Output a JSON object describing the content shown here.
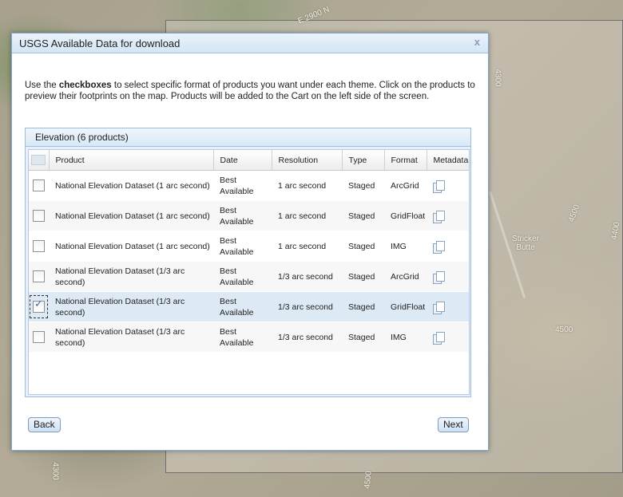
{
  "map": {
    "labels": {
      "road": "E 2900 N",
      "contour_1": "4300",
      "contour_2": "4500",
      "contour_3": "4500",
      "contour_4": "4400",
      "contour_5": "4300",
      "contour_6": "4500",
      "place": "Stricker Butte"
    }
  },
  "dialog": {
    "title": "USGS Available Data for download",
    "close": "x",
    "instructions": {
      "part1": "Use the ",
      "bold": "checkboxes",
      "part2": " to select specific format of products you want under each theme. Click on the products to preview their footprints on the map. Products will be added to the Cart on the left side of the screen."
    },
    "panel_title": "Elevation (6 products)",
    "columns": [
      "Product",
      "Date",
      "Resolution",
      "Type",
      "Format",
      "Metadata"
    ],
    "rows": [
      {
        "product": "National Elevation Dataset (1 arc second)",
        "date": "Best Available",
        "resolution": "1 arc second",
        "type": "Staged",
        "format": "ArcGrid",
        "checked": false
      },
      {
        "product": "National Elevation Dataset (1 arc second)",
        "date": "Best Available",
        "resolution": "1 arc second",
        "type": "Staged",
        "format": "GridFloat",
        "checked": false
      },
      {
        "product": "National Elevation Dataset (1 arc second)",
        "date": "Best Available",
        "resolution": "1 arc second",
        "type": "Staged",
        "format": "IMG",
        "checked": false
      },
      {
        "product": "National Elevation Dataset (1/3 arc second)",
        "date": "Best Available",
        "resolution": "1/3 arc second",
        "type": "Staged",
        "format": "ArcGrid",
        "checked": false
      },
      {
        "product": "National Elevation Dataset (1/3 arc second)",
        "date": "Best Available",
        "resolution": "1/3 arc second",
        "type": "Staged",
        "format": "GridFloat",
        "checked": true
      },
      {
        "product": "National Elevation Dataset (1/3 arc second)",
        "date": "Best Available",
        "resolution": "1/3 arc second",
        "type": "Staged",
        "format": "IMG",
        "checked": false
      }
    ],
    "buttons": {
      "back": "Back",
      "next": "Next"
    }
  },
  "colors": {
    "dialog_border": "#7fa6cf",
    "title_bar": "#d3e5f5",
    "selected_row": "#dde9f5"
  }
}
